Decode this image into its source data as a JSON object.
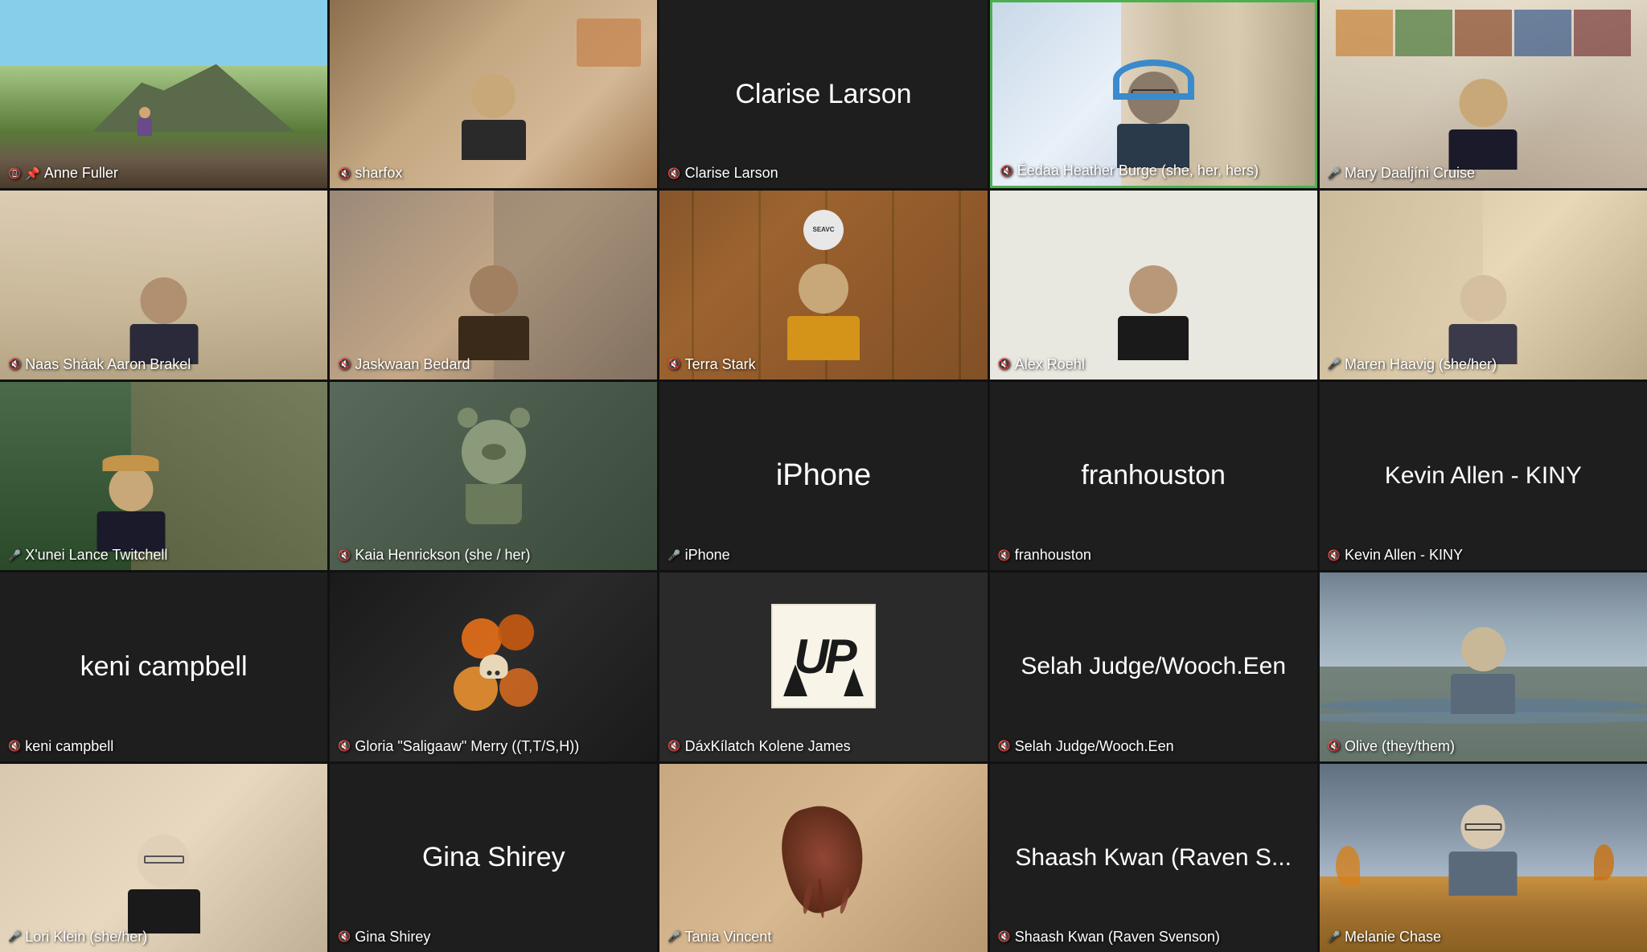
{
  "participants": [
    {
      "id": "anne-fuller",
      "name": "Anne Fuller",
      "label": "Anne Fuller",
      "micMuted": true,
      "pinned": true,
      "hasVideo": true,
      "bgClass": "bg-mountain",
      "videoType": "outdoor",
      "activeSpeaker": false,
      "row": 1,
      "col": 1
    },
    {
      "id": "sharfox",
      "name": "sharfox",
      "label": "sharfox",
      "micMuted": true,
      "hasVideo": true,
      "bgClass": "bg-room1",
      "videoType": "indoor",
      "activeSpeaker": false,
      "row": 1,
      "col": 2
    },
    {
      "id": "clarise-larson",
      "name": "Clarise Larson",
      "label": "Clarise Larson",
      "micMuted": true,
      "hasVideo": false,
      "bgClass": "tile-bg-dark",
      "videoType": "name-only",
      "activeSpeaker": false,
      "row": 1,
      "col": 3
    },
    {
      "id": "edaa-heather",
      "name": "Éedaa Heather Burge (she, her, hers)",
      "label": "Éedaa Heather Burge (she, her, hers)",
      "micMuted": true,
      "hasVideo": true,
      "bgClass": "bg-room2",
      "videoType": "indoor",
      "activeSpeaker": true,
      "row": 1,
      "col": 4
    },
    {
      "id": "mary-cruise",
      "name": "Mary Daaljíni Cruise",
      "label": "Mary Daaljíni Cruise",
      "micMuted": false,
      "hasVideo": true,
      "bgClass": "bg-bookshelf",
      "videoType": "indoor",
      "activeSpeaker": false,
      "row": 1,
      "col": 5
    },
    {
      "id": "naas-aaron",
      "name": "Naas Sháak Aaron Brakel",
      "label": "Naas Sháak Aaron Brakel",
      "micMuted": true,
      "hasVideo": true,
      "bgClass": "bg-room3",
      "videoType": "indoor",
      "activeSpeaker": false,
      "row": 2,
      "col": 1
    },
    {
      "id": "jaskwaan",
      "name": "Jaskwaan Bedard",
      "label": "Jaskwaan Bedard",
      "micMuted": true,
      "hasVideo": true,
      "bgClass": "bg-room4",
      "videoType": "indoor",
      "activeSpeaker": false,
      "row": 2,
      "col": 2
    },
    {
      "id": "terra-stark",
      "name": "Terra Stark",
      "label": "Terra Stark",
      "micMuted": true,
      "hasVideo": true,
      "bgClass": "bg-wood",
      "videoType": "indoor",
      "activeSpeaker": false,
      "row": 2,
      "col": 3
    },
    {
      "id": "alex-roehl",
      "name": "Alex Roehl",
      "label": "Alex Roehl",
      "micMuted": true,
      "hasVideo": true,
      "bgClass": "bg-white-room",
      "videoType": "indoor",
      "activeSpeaker": false,
      "row": 2,
      "col": 4
    },
    {
      "id": "maren-haavig",
      "name": "Maren Haavig (she/her)",
      "label": "Maren Haavig (she/her)",
      "micMuted": false,
      "hasVideo": true,
      "bgClass": "bg-room5",
      "videoType": "indoor",
      "activeSpeaker": false,
      "row": 2,
      "col": 5
    },
    {
      "id": "xunei-lance",
      "name": "X'unei Lance Twitchell",
      "label": "X'unei Lance Twitchell",
      "micMuted": false,
      "hasVideo": true,
      "bgClass": "bg-room6",
      "videoType": "indoor",
      "activeSpeaker": false,
      "row": 3,
      "col": 1
    },
    {
      "id": "kaia-henrickson",
      "name": "Kaia Henrickson (she / her)",
      "label": "Kaia Henrickson (she / her)",
      "micMuted": true,
      "hasVideo": true,
      "bgClass": "bg-room7",
      "videoType": "stuffed-animal",
      "activeSpeaker": false,
      "row": 3,
      "col": 2
    },
    {
      "id": "iphone",
      "name": "iPhone",
      "label": "iPhone",
      "displayName": "iPhone",
      "micMuted": false,
      "hasVideo": false,
      "bgClass": "tile-bg-dark",
      "videoType": "name-only",
      "activeSpeaker": false,
      "row": 3,
      "col": 3
    },
    {
      "id": "franhouston",
      "name": "franhouston",
      "label": "franhouston",
      "displayName": "franhouston",
      "micMuted": true,
      "hasVideo": false,
      "bgClass": "tile-bg-dark",
      "videoType": "name-only",
      "activeSpeaker": false,
      "row": 3,
      "col": 4
    },
    {
      "id": "kevin-allen",
      "name": "Kevin Allen - KINY",
      "label": "Kevin Allen - KINY",
      "displayName": "Kevin Allen - KINY",
      "micMuted": true,
      "hasVideo": false,
      "bgClass": "tile-bg-dark",
      "videoType": "name-only",
      "activeSpeaker": false,
      "row": 3,
      "col": 5
    },
    {
      "id": "keni-campbell",
      "name": "keni campbell",
      "label": "keni campbell",
      "displayName": "keni campbell",
      "micMuted": true,
      "hasVideo": false,
      "bgClass": "tile-bg-dark",
      "videoType": "name-only",
      "activeSpeaker": false,
      "row": 4,
      "col": 1
    },
    {
      "id": "gloria-merry",
      "name": "Gloria \"Saligaaw\" Merry ((T,T/S,H))",
      "label": "Gloria \"Saligaaw\" Merry ((T,T/S,H))",
      "micMuted": true,
      "hasVideo": true,
      "bgClass": "bg-warm",
      "videoType": "artwork",
      "activeSpeaker": false,
      "row": 4,
      "col": 2
    },
    {
      "id": "daxkilatch",
      "name": "DáxKílatch Kolene James",
      "label": "DáxKílatch Kolene James",
      "micMuted": true,
      "hasVideo": true,
      "bgClass": "tile-bg-mid",
      "videoType": "logo",
      "activeSpeaker": false,
      "row": 4,
      "col": 3
    },
    {
      "id": "selah-judge",
      "name": "Selah Judge/Wooch.Een",
      "label": "Selah Judge/Wooch.Een",
      "displayName": "Selah Judge/Wooch.Een",
      "micMuted": true,
      "hasVideo": false,
      "bgClass": "tile-bg-dark",
      "videoType": "name-only",
      "activeSpeaker": false,
      "row": 4,
      "col": 4
    },
    {
      "id": "olive",
      "name": "Olive (they/them)",
      "label": "Olive (they/them)",
      "micMuted": true,
      "hasVideo": true,
      "bgClass": "bg-outside",
      "videoType": "outdoor",
      "activeSpeaker": false,
      "row": 4,
      "col": 5
    },
    {
      "id": "lori-klein",
      "name": "Lori Klein (she/her)",
      "label": "Lori Klein (she/her)",
      "micMuted": false,
      "hasVideo": true,
      "bgClass": "bg-room3",
      "videoType": "indoor",
      "activeSpeaker": false,
      "row": 5,
      "col": 1
    },
    {
      "id": "gina-shirey",
      "name": "Gina Shirey",
      "label": "Gina Shirey",
      "displayName": "Gina Shirey",
      "micMuted": true,
      "hasVideo": false,
      "bgClass": "tile-bg-dark",
      "videoType": "name-only",
      "activeSpeaker": false,
      "row": 5,
      "col": 2
    },
    {
      "id": "tania-vincent",
      "name": "Tania Vincent",
      "label": "Tania Vincent",
      "micMuted": false,
      "hasVideo": true,
      "bgClass": "bg-room1",
      "videoType": "photo",
      "activeSpeaker": false,
      "row": 5,
      "col": 3
    },
    {
      "id": "shaash-kwan",
      "name": "Shaash Kwan (Raven Svenson)",
      "label": "Shaash Kwan (Raven Svenson)",
      "displayName": "Shaash Kwan (Raven S...",
      "micMuted": true,
      "hasVideo": false,
      "bgClass": "tile-bg-dark",
      "videoType": "name-only",
      "activeSpeaker": false,
      "row": 5,
      "col": 4
    },
    {
      "id": "melanie-chase",
      "name": "Melanie Chase",
      "label": "Melanie Chase",
      "micMuted": false,
      "hasVideo": true,
      "bgClass": "bg-beach",
      "videoType": "outdoor",
      "activeSpeaker": false,
      "row": 5,
      "col": 5
    }
  ]
}
